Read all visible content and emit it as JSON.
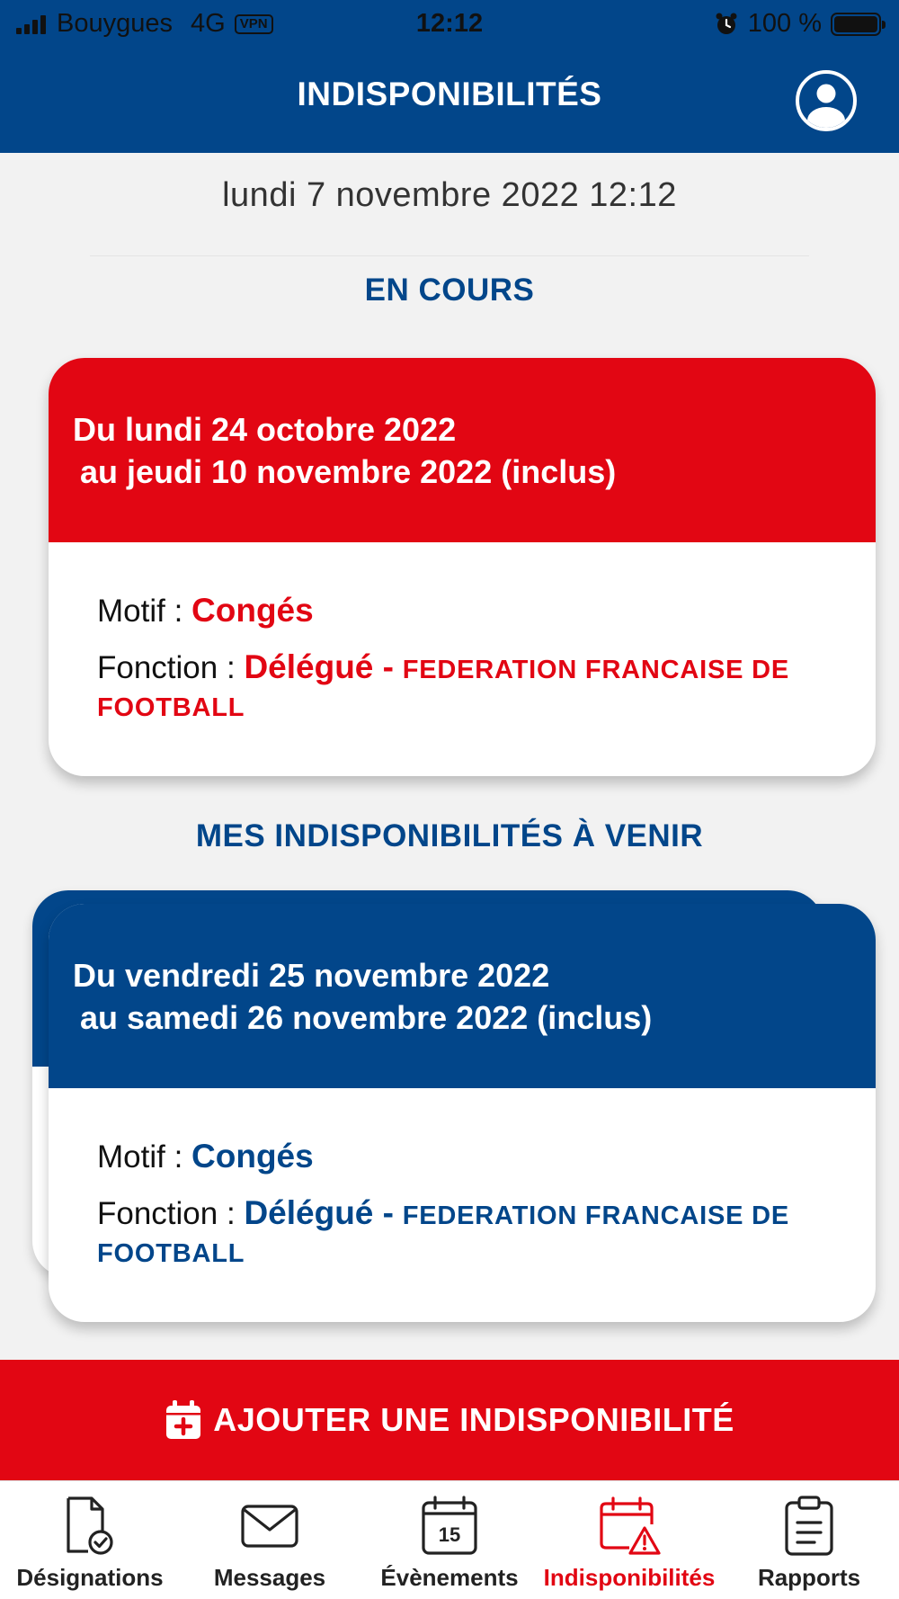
{
  "status_bar": {
    "carrier": "Bouygues",
    "network": "4G",
    "vpn": "VPN",
    "time": "12:12",
    "battery": "100 %",
    "battery_level": 1.0
  },
  "header": {
    "title": "INDISPONIBILITÉS",
    "profile_icon": "user-circle-icon"
  },
  "current_datetime": "lundi 7 novembre 2022 12:12",
  "sections": {
    "current_title": "EN COURS",
    "upcoming_title": "MES INDISPONIBILITÉS À VENIR"
  },
  "current_card": {
    "line1": "Du lundi 24 octobre 2022",
    "line2": "au jeudi 10 novembre 2022 (inclus)",
    "motif_label": "Motif :",
    "motif_value": "Congés",
    "fonction_label": "Fonction :",
    "fonction_value": "Délégué -",
    "organisation": "FEDERATION FRANCAISE DE FOOTBALL"
  },
  "upcoming_card": {
    "line1": "Du vendredi 25 novembre 2022",
    "line2": "au samedi 26 novembre 2022 (inclus)",
    "motif_label": "Motif :",
    "motif_value": "Congés",
    "fonction_label": "Fonction :",
    "fonction_value": "Délégué -",
    "organisation": "FEDERATION FRANCAISE DE FOOTBALL"
  },
  "add_button": {
    "label": "AJOUTER UNE INDISPONIBILITÉ",
    "icon": "calendar-plus-icon"
  },
  "tabs": [
    {
      "label": "Désignations",
      "icon": "document-check-icon"
    },
    {
      "label": "Messages",
      "icon": "envelope-icon"
    },
    {
      "label": "Évènements",
      "icon": "calendar-15-icon"
    },
    {
      "label": "Indisponibilités",
      "icon": "calendar-warning-icon",
      "active": true
    },
    {
      "label": "Rapports",
      "icon": "clipboard-icon"
    }
  ],
  "colors": {
    "primary_blue": "#02468a",
    "accent_red": "#e20613",
    "background": "#f2f2f2"
  }
}
